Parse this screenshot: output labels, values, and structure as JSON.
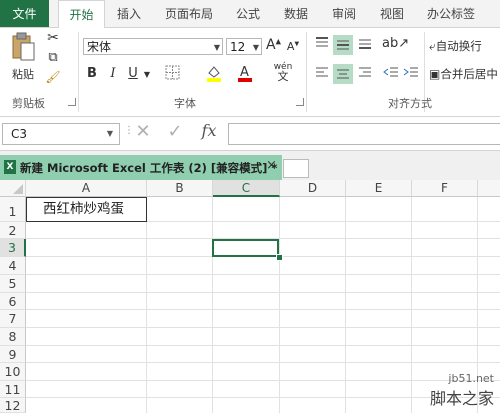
{
  "ribbon_tabs": [
    "文件",
    "开始",
    "插入",
    "页面布局",
    "公式",
    "数据",
    "审阅",
    "视图",
    "办公标签"
  ],
  "clipboard": {
    "paste_label": "粘贴",
    "group_label": "剪贴板"
  },
  "font": {
    "name": "宋体",
    "size": "12",
    "group_label": "字体",
    "bold": "B",
    "italic": "I",
    "underline": "U",
    "phonetic": "wén",
    "grow": "A",
    "shrink": "A"
  },
  "alignment": {
    "wrap_text": "自动换行",
    "merge_center": "合并后居中",
    "group_label": "对齐方式"
  },
  "formula_bar": {
    "name_box": "C3",
    "fx": "fx",
    "formula": ""
  },
  "workbook_tab": {
    "title": "新建 Microsoft Excel 工作表 (2)  [兼容模式] *",
    "close": "×"
  },
  "grid": {
    "columns": [
      "A",
      "B",
      "C",
      "D",
      "E",
      "F"
    ],
    "rows": [
      "1",
      "2",
      "3",
      "4",
      "5",
      "6",
      "7",
      "8",
      "9",
      "10",
      "11",
      "12"
    ],
    "active_cell": "C3",
    "cells": {
      "A1": "西红柿炒鸡蛋"
    }
  },
  "watermark": {
    "line1": "jb51.net",
    "line2": "脚本之家"
  },
  "colors": {
    "excel_green": "#217346",
    "workbook_tab": "#8fcfb0"
  },
  "icons": [
    "cut-icon",
    "copy-icon",
    "format-painter-icon",
    "paste-icon",
    "fill-color-icon",
    "font-color-icon",
    "borders-icon",
    "cancel-icon",
    "enter-icon",
    "excel-file-icon"
  ]
}
